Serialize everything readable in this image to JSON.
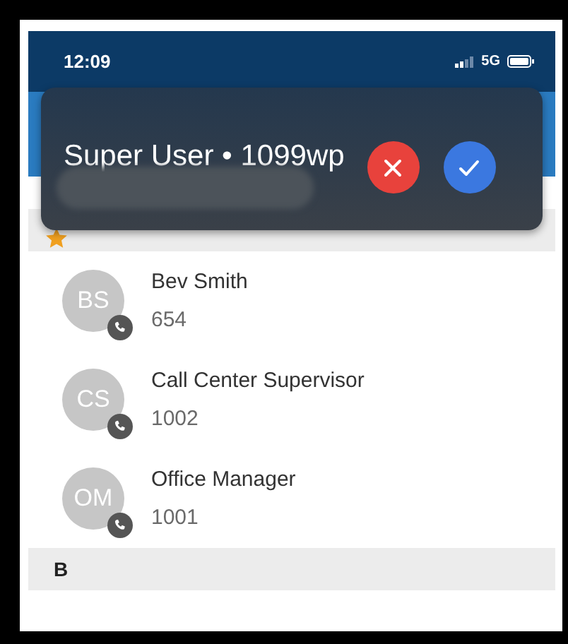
{
  "status_bar": {
    "time": "12:09",
    "network": "5G"
  },
  "call_popup": {
    "title": "Super User • 1099wp",
    "redacted": true
  },
  "sections": [
    {
      "kind": "favorites",
      "contacts": [
        {
          "initials": "BS",
          "name": "Bev Smith",
          "number": "654"
        },
        {
          "initials": "CS",
          "name": "Call Center Supervisor",
          "number": "1002"
        },
        {
          "initials": "OM",
          "name": "Office Manager",
          "number": "1001"
        }
      ]
    },
    {
      "kind": "letter",
      "label": "B"
    }
  ]
}
